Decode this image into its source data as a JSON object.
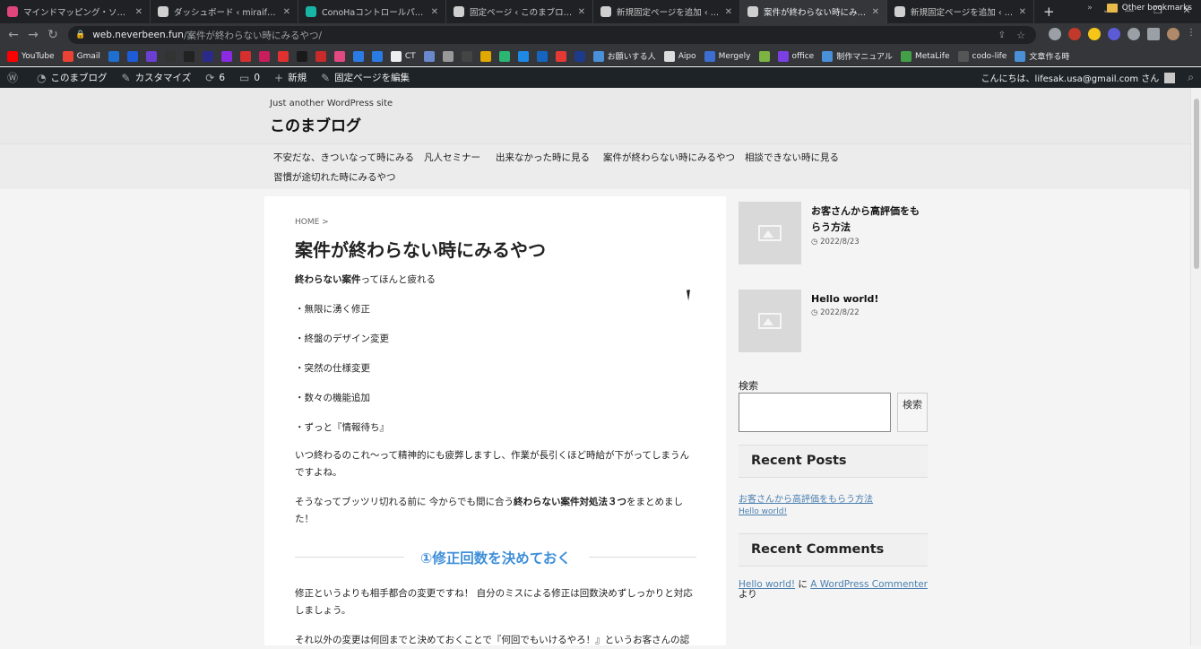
{
  "tabs": [
    {
      "title": "マインドマッピング・ソフトウェア - オン",
      "color": "#e0457b"
    },
    {
      "title": "ダッシュボード ‹ miraiful — WordPress",
      "color": "#cfcfcf"
    },
    {
      "title": "ConoHaコントロールパネル",
      "color": "#18b5a6"
    },
    {
      "title": "固定ページ ‹ このまブログ — WordPress",
      "color": "#cfcfcf"
    },
    {
      "title": "新規固定ページを追加 ‹ このまブログ",
      "color": "#cfcfcf"
    },
    {
      "title": "案件が終わらない時にみるやつ - このま",
      "color": "#cfcfcf"
    },
    {
      "title": "新規固定ページを追加 ‹ このまブログ",
      "color": "#cfcfcf"
    }
  ],
  "url": {
    "host": "web.neverbeen.fun",
    "path": "/案件が終わらない時にみるやつ/"
  },
  "bookmarks": [
    {
      "label": "YouTube",
      "color": "#ff0000"
    },
    {
      "label": "Gmail",
      "color": "#ea4335"
    },
    {
      "label": "",
      "color": "#1f6fd1"
    },
    {
      "label": "",
      "color": "#1e5bd6"
    },
    {
      "label": "",
      "color": "#6b3fd1"
    },
    {
      "label": "",
      "color": "#333333"
    },
    {
      "label": "",
      "color": "#222222"
    },
    {
      "label": "",
      "color": "#2a2a8a"
    },
    {
      "label": "",
      "color": "#8a2be2"
    },
    {
      "label": "",
      "color": "#d62f2f"
    },
    {
      "label": "",
      "color": "#c81e5a"
    },
    {
      "label": "",
      "color": "#e03030"
    },
    {
      "label": "",
      "color": "#1a1a1a"
    },
    {
      "label": "",
      "color": "#c92a2a"
    },
    {
      "label": "",
      "color": "#e24a7f"
    },
    {
      "label": "",
      "color": "#2c7be5"
    },
    {
      "label": "",
      "color": "#2a7ae4"
    },
    {
      "label": "CT",
      "color": "#eeeeee"
    },
    {
      "label": "",
      "color": "#6a89cc"
    },
    {
      "label": "",
      "color": "#999999"
    },
    {
      "label": "",
      "color": "#444444"
    },
    {
      "label": "",
      "color": "#e0a800"
    },
    {
      "label": "",
      "color": "#2bb673"
    },
    {
      "label": "",
      "color": "#1e88e5"
    },
    {
      "label": "",
      "color": "#1565c0"
    },
    {
      "label": "",
      "color": "#e53935"
    },
    {
      "label": "",
      "color": "#1e3a8a"
    },
    {
      "label": "お願いする人",
      "color": "#4a90d9"
    },
    {
      "label": "Aipo",
      "color": "#dddddd"
    },
    {
      "label": "Mergely",
      "color": "#3c6fd1"
    },
    {
      "label": "",
      "color": "#7cb342"
    },
    {
      "label": "office",
      "color": "#7b3fe4"
    },
    {
      "label": "制作マニュアル",
      "color": "#4a90d9"
    },
    {
      "label": "MetaLife",
      "color": "#43a047"
    },
    {
      "label": "codo-life",
      "color": "#555555"
    },
    {
      "label": "文章作る時",
      "color": "#4a90d9"
    }
  ],
  "bookmarks_other": "Other bookmarks",
  "adminbar": {
    "site": "このまブログ",
    "customize": "カスタマイズ",
    "updates": "6",
    "comments": "0",
    "new": "新規",
    "edit": "固定ページを編集",
    "greeting": "こんにちは、lifesak.usa@gmail.com さん"
  },
  "site": {
    "tagline": "Just another WordPress site",
    "title": "このまブログ"
  },
  "nav": [
    "不安だな、きついなって時にみる",
    "凡人セミナー",
    "出来なかった時に見る",
    "案件が終わらない時にみるやつ",
    "相談できない時に見る",
    "習慣が途切れた時にみるやつ"
  ],
  "page": {
    "breadcrumb": "HOME >",
    "title": "案件が終わらない時にみるやつ",
    "intro_bold": "終わらない案件",
    "intro_rest": "ってほんと疲れる",
    "bullets": [
      "・無限に湧く修正",
      "・終盤のデザイン変更",
      "・突然の仕様変更",
      "・数々の機能追加",
      "・ずっと『情報待ち』"
    ],
    "p1": "いつ終わるのこれ〜って精神的にも疲弊しますし、作業が長引くほど時給が下がってしまうんですよね。",
    "p2_a": "そうなってブッツリ切れる前に 今からでも間に合う",
    "p2_bold": "終わらない案件対処法３つ",
    "p2_b": "をまとめました！",
    "h2": "①修正回数を決めておく",
    "p3": "修正というよりも相手都合の変更ですね！ 自分のミスによる修正は回数決めずしっかりと対応しましょう。",
    "p4": "それ以外の変更は何回までと決めておくことで『何回でもいけるやろ！』というお客さんの認"
  },
  "sidebar": {
    "posts": [
      {
        "title": "お客さんから高評価をもらう方法",
        "date": "2022/8/23"
      },
      {
        "title": "Hello world!",
        "date": "2022/8/22"
      }
    ],
    "search_label": "検索",
    "search_button": "検索",
    "recent_posts_title": "Recent Posts",
    "recent_posts": [
      "お客さんから高評価をもらう方法",
      "Hello world!"
    ],
    "recent_comments_title": "Recent Comments",
    "comment_post": "Hello world!",
    "comment_sep": " に ",
    "comment_author": "A WordPress Commenter",
    "comment_tail": "より"
  }
}
